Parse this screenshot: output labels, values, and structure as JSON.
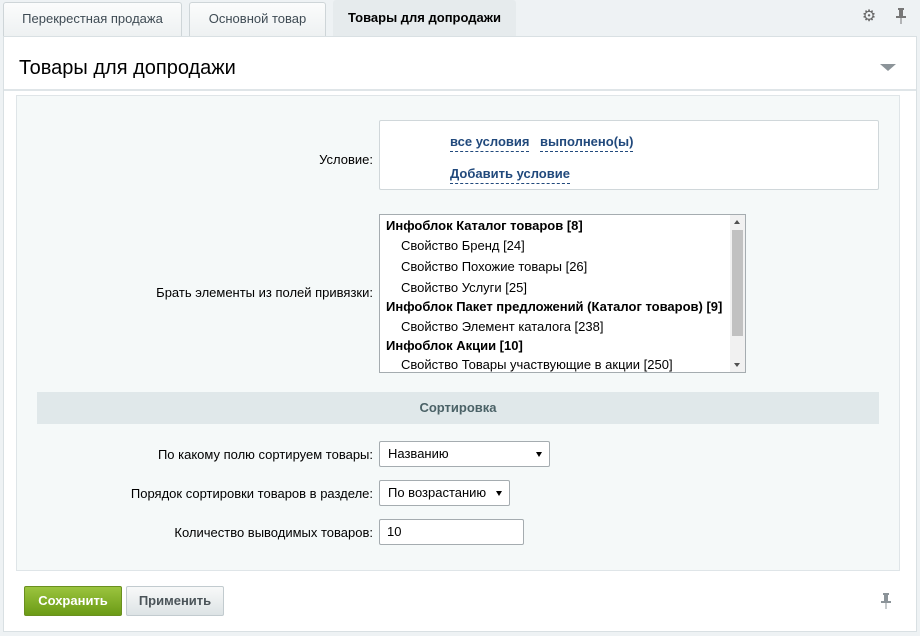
{
  "tabs": [
    {
      "label": "Перекрестная продажа"
    },
    {
      "label": "Основной товар"
    },
    {
      "label": "Товары для допродажи"
    }
  ],
  "tab_icons": [
    "gear-icon",
    "pin-icon"
  ],
  "panel": {
    "title": "Товары для допродажи"
  },
  "condition": {
    "label": "Условие:",
    "all_conditions": "все условия",
    "fulfilled": "выполнено(ы)",
    "add_condition": "Добавить условие"
  },
  "binding": {
    "label": "Брать элементы из полей привязки:",
    "items": [
      {
        "text": "Инфоблок Каталог товаров [8]",
        "group": true
      },
      {
        "text": "Свойство Бренд [24]",
        "group": false
      },
      {
        "text": "Свойство Похожие товары [26]",
        "group": false
      },
      {
        "text": "Свойство Услуги [25]",
        "group": false
      },
      {
        "text": "Инфоблок Пакет предложений (Каталог товаров) [9]",
        "group": true
      },
      {
        "text": "Свойство Элемент каталога [238]",
        "group": false
      },
      {
        "text": "Инфоблок Акции [10]",
        "group": true
      },
      {
        "text": "Свойство Товары участвующие в акции [250]",
        "group": false
      }
    ]
  },
  "sorting": {
    "section_title": "Сортировка",
    "field_label": "По какому полю сортируем товары:",
    "field_value": "Названию",
    "order_label": "Порядок сортировки товаров в разделе:",
    "order_value": "По возрастанию",
    "count_label": "Количество выводимых товаров:",
    "count_value": "10"
  },
  "buttons": {
    "save": "Сохранить",
    "apply": "Применить"
  },
  "colors": {
    "save_button": "#7aa626",
    "link": "#21497c",
    "section_header": "#e0e8ea"
  }
}
